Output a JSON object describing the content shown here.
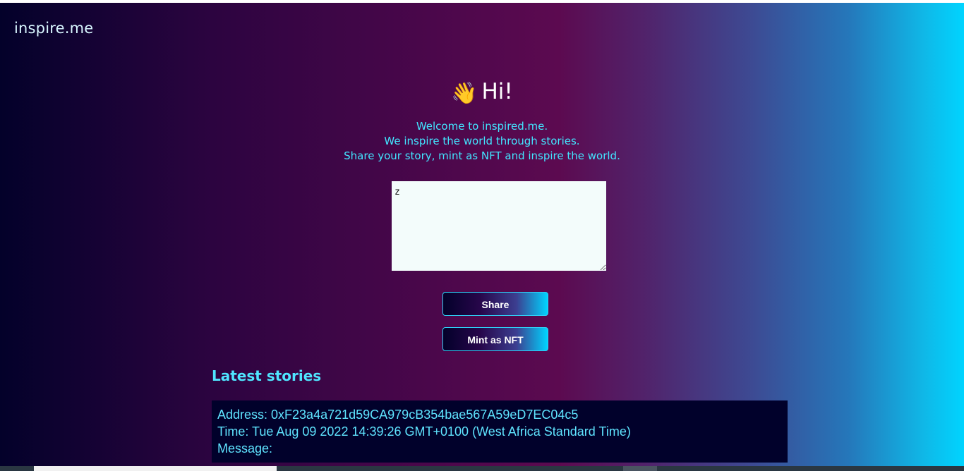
{
  "header": {
    "brand": "inspire.me"
  },
  "hero": {
    "wave_emoji": "👋",
    "greeting": "Hi!",
    "intro_lines": [
      "Welcome to inspired.me.",
      "We inspire the world through stories.",
      "Share your story, mint as NFT and inspire the world."
    ]
  },
  "form": {
    "story_value": "z",
    "share_label": "Share",
    "mint_label": "Mint as NFT"
  },
  "latest": {
    "heading": "Latest stories",
    "stories": [
      {
        "address": "Address: 0xF23a4a721d59CA979cB354bae567A59eD7EC04c5",
        "time": "Time: Tue Aug 09 2022 14:39:26 GMT+0100 (West Africa Standard Time)",
        "message": "Message:"
      }
    ]
  },
  "colors": {
    "accent_cyan": "#00d4ff",
    "deep_navy": "#03012a",
    "magenta": "#5c0a50",
    "intro_text": "#42e5ff"
  }
}
